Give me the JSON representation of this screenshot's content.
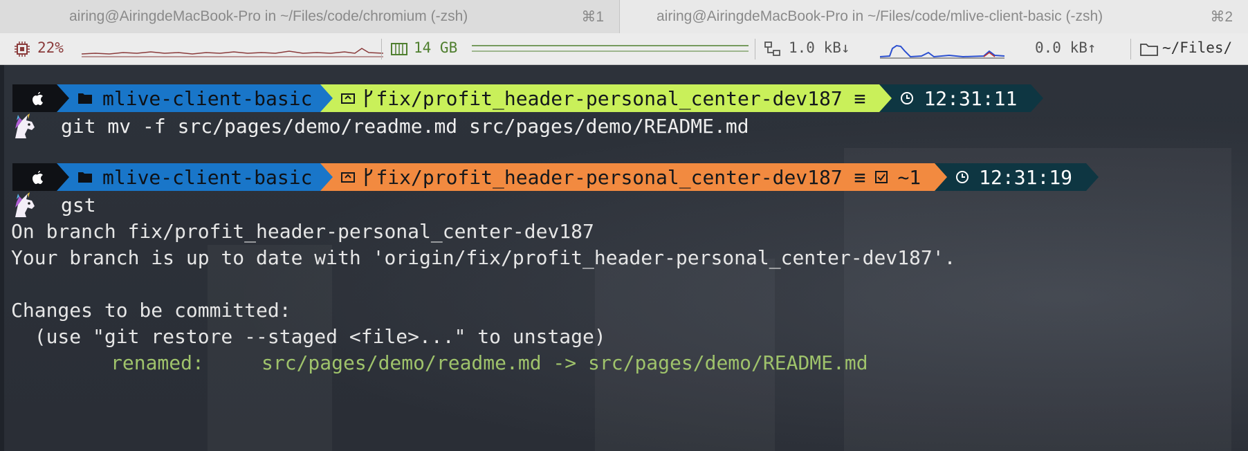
{
  "tabs": [
    {
      "title": "airing@AiringdeMacBook-Pro in ~/Files/code/chromium (-zsh)",
      "shortcut": "⌘1"
    },
    {
      "title": "airing@AiringdeMacBook-Pro in ~/Files/code/mlive-client-basic (-zsh)",
      "shortcut": "⌘2"
    }
  ],
  "statusbar": {
    "cpu": "22%",
    "memory": "14 GB",
    "net_down": "1.0 kB↓",
    "net_up": "0.0 kB↑",
    "path": "~/Files/"
  },
  "prompts": [
    {
      "apple": "",
      "dir": "mlive-client-basic",
      "git": "fix/profit_header-personal_center-dev187 ≡",
      "git_extra": "",
      "time": "12:31:11",
      "git_color": "#c9f05a"
    },
    {
      "apple": "",
      "dir": "mlive-client-basic",
      "git": "fix/profit_header-personal_center-dev187 ≡",
      "git_extra": "~1",
      "time": "12:31:19",
      "git_color": "#f28a40"
    }
  ],
  "commands": [
    "git mv -f src/pages/demo/readme.md src/pages/demo/README.md",
    "gst"
  ],
  "output": {
    "line1": "On branch fix/profit_header-personal_center-dev187",
    "line2": "Your branch is up to date with 'origin/fix/profit_header-personal_center-dev187'.",
    "line3": "Changes to be committed:",
    "line4": "  (use \"git restore --staged <file>...\" to unstage)",
    "renamed_label": "renamed:",
    "renamed_value": "src/pages/demo/readme.md -> src/pages/demo/README.md"
  },
  "colors": {
    "dir_segment": "#1976c9",
    "git_clean": "#c9f05a",
    "git_dirty": "#f28a40",
    "time_segment": "#0e3642",
    "renamed_text": "#9fc36b"
  }
}
